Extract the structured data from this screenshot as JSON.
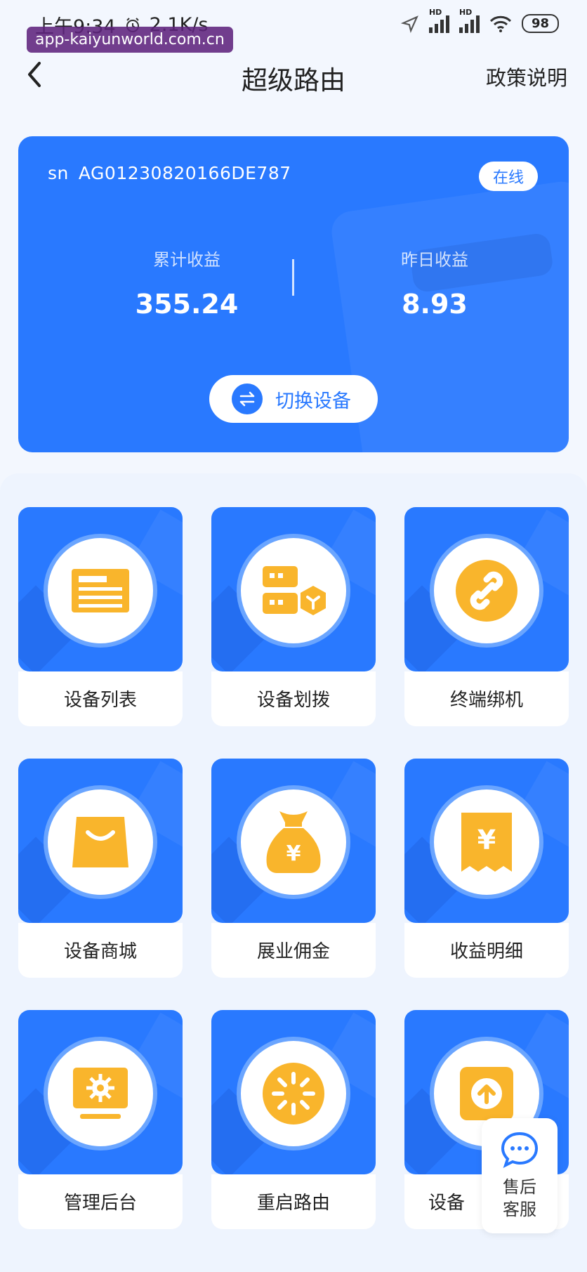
{
  "status_bar": {
    "time": "上午9:34",
    "speed": "2.1K/s",
    "battery": "98",
    "hd_labels": [
      "HD",
      "HD"
    ]
  },
  "watermark": "app-kaiyunworld.com.cn",
  "nav": {
    "title": "超级路由",
    "right_link": "政策说明"
  },
  "card": {
    "sn_label": "sn",
    "sn_value": "AG01230820166DE787",
    "status": "在线",
    "stats": [
      {
        "label": "累计收益",
        "value": "355.24"
      },
      {
        "label": "昨日收益",
        "value": "8.93"
      }
    ],
    "switch_label": "切换设备"
  },
  "tiles": [
    {
      "label": "设备列表",
      "icon": "card-icon"
    },
    {
      "label": "设备划拨",
      "icon": "server-transfer-icon"
    },
    {
      "label": "终端绑机",
      "icon": "link-icon"
    },
    {
      "label": "设备商城",
      "icon": "shopping-bag-icon"
    },
    {
      "label": "展业佣金",
      "icon": "money-bag-icon"
    },
    {
      "label": "收益明细",
      "icon": "receipt-icon"
    },
    {
      "label": "管理后台",
      "icon": "admin-panel-icon"
    },
    {
      "label": "重启路由",
      "icon": "restart-icon"
    },
    {
      "label": "设备",
      "icon": "upload-icon"
    }
  ],
  "customer_service": {
    "label_line1": "售后",
    "label_line2": "客服"
  },
  "colors": {
    "primary": "#2979ff",
    "icon_accent": "#f9b52c",
    "background": "#f3f7fe"
  }
}
